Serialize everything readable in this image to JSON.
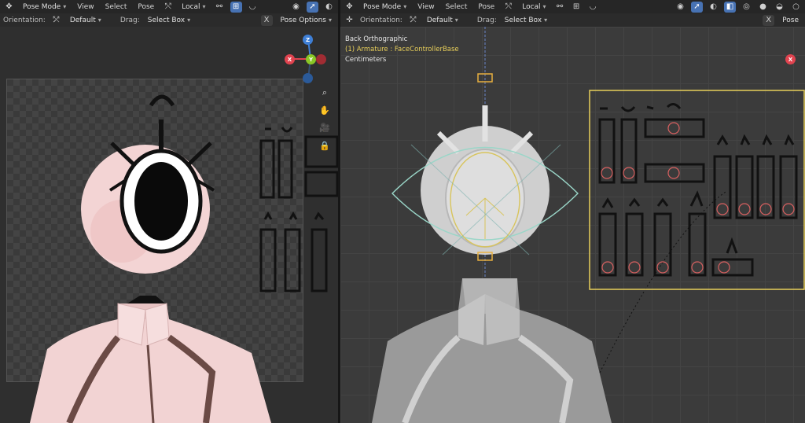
{
  "left_viewport": {
    "header": {
      "mode": "Pose Mode",
      "menus": [
        "View",
        "Select",
        "Pose"
      ],
      "transform_orientation": "Local"
    },
    "subheader": {
      "orientation_label": "Orientation:",
      "orientation_value": "Default",
      "drag_label": "Drag:",
      "drag_value": "Select Box",
      "close_label": "X",
      "pose_options": "Pose Options"
    },
    "gizmo": {
      "x": "X",
      "y": "Y",
      "z": "Z"
    }
  },
  "right_viewport": {
    "header": {
      "mode": "Pose Mode",
      "menus": [
        "View",
        "Select",
        "Pose"
      ],
      "transform_orientation": "Local"
    },
    "subheader": {
      "orientation_label": "Orientation:",
      "orientation_value": "Default",
      "drag_label": "Drag:",
      "drag_value": "Select Box",
      "close_label": "X",
      "pose_options": "Pose"
    },
    "overlay": {
      "view_name": "Back Orthographic",
      "active_object": "(1) Armature : FaceControllerBase",
      "units": "Centimeters"
    },
    "gizmo": {
      "x": "X"
    }
  },
  "colors": {
    "accent": "#4772b3",
    "gizmo_x": "#e0434f",
    "gizmo_y": "#8ac626",
    "gizmo_z": "#3e7fd6",
    "selection": "#e8cf5a"
  }
}
